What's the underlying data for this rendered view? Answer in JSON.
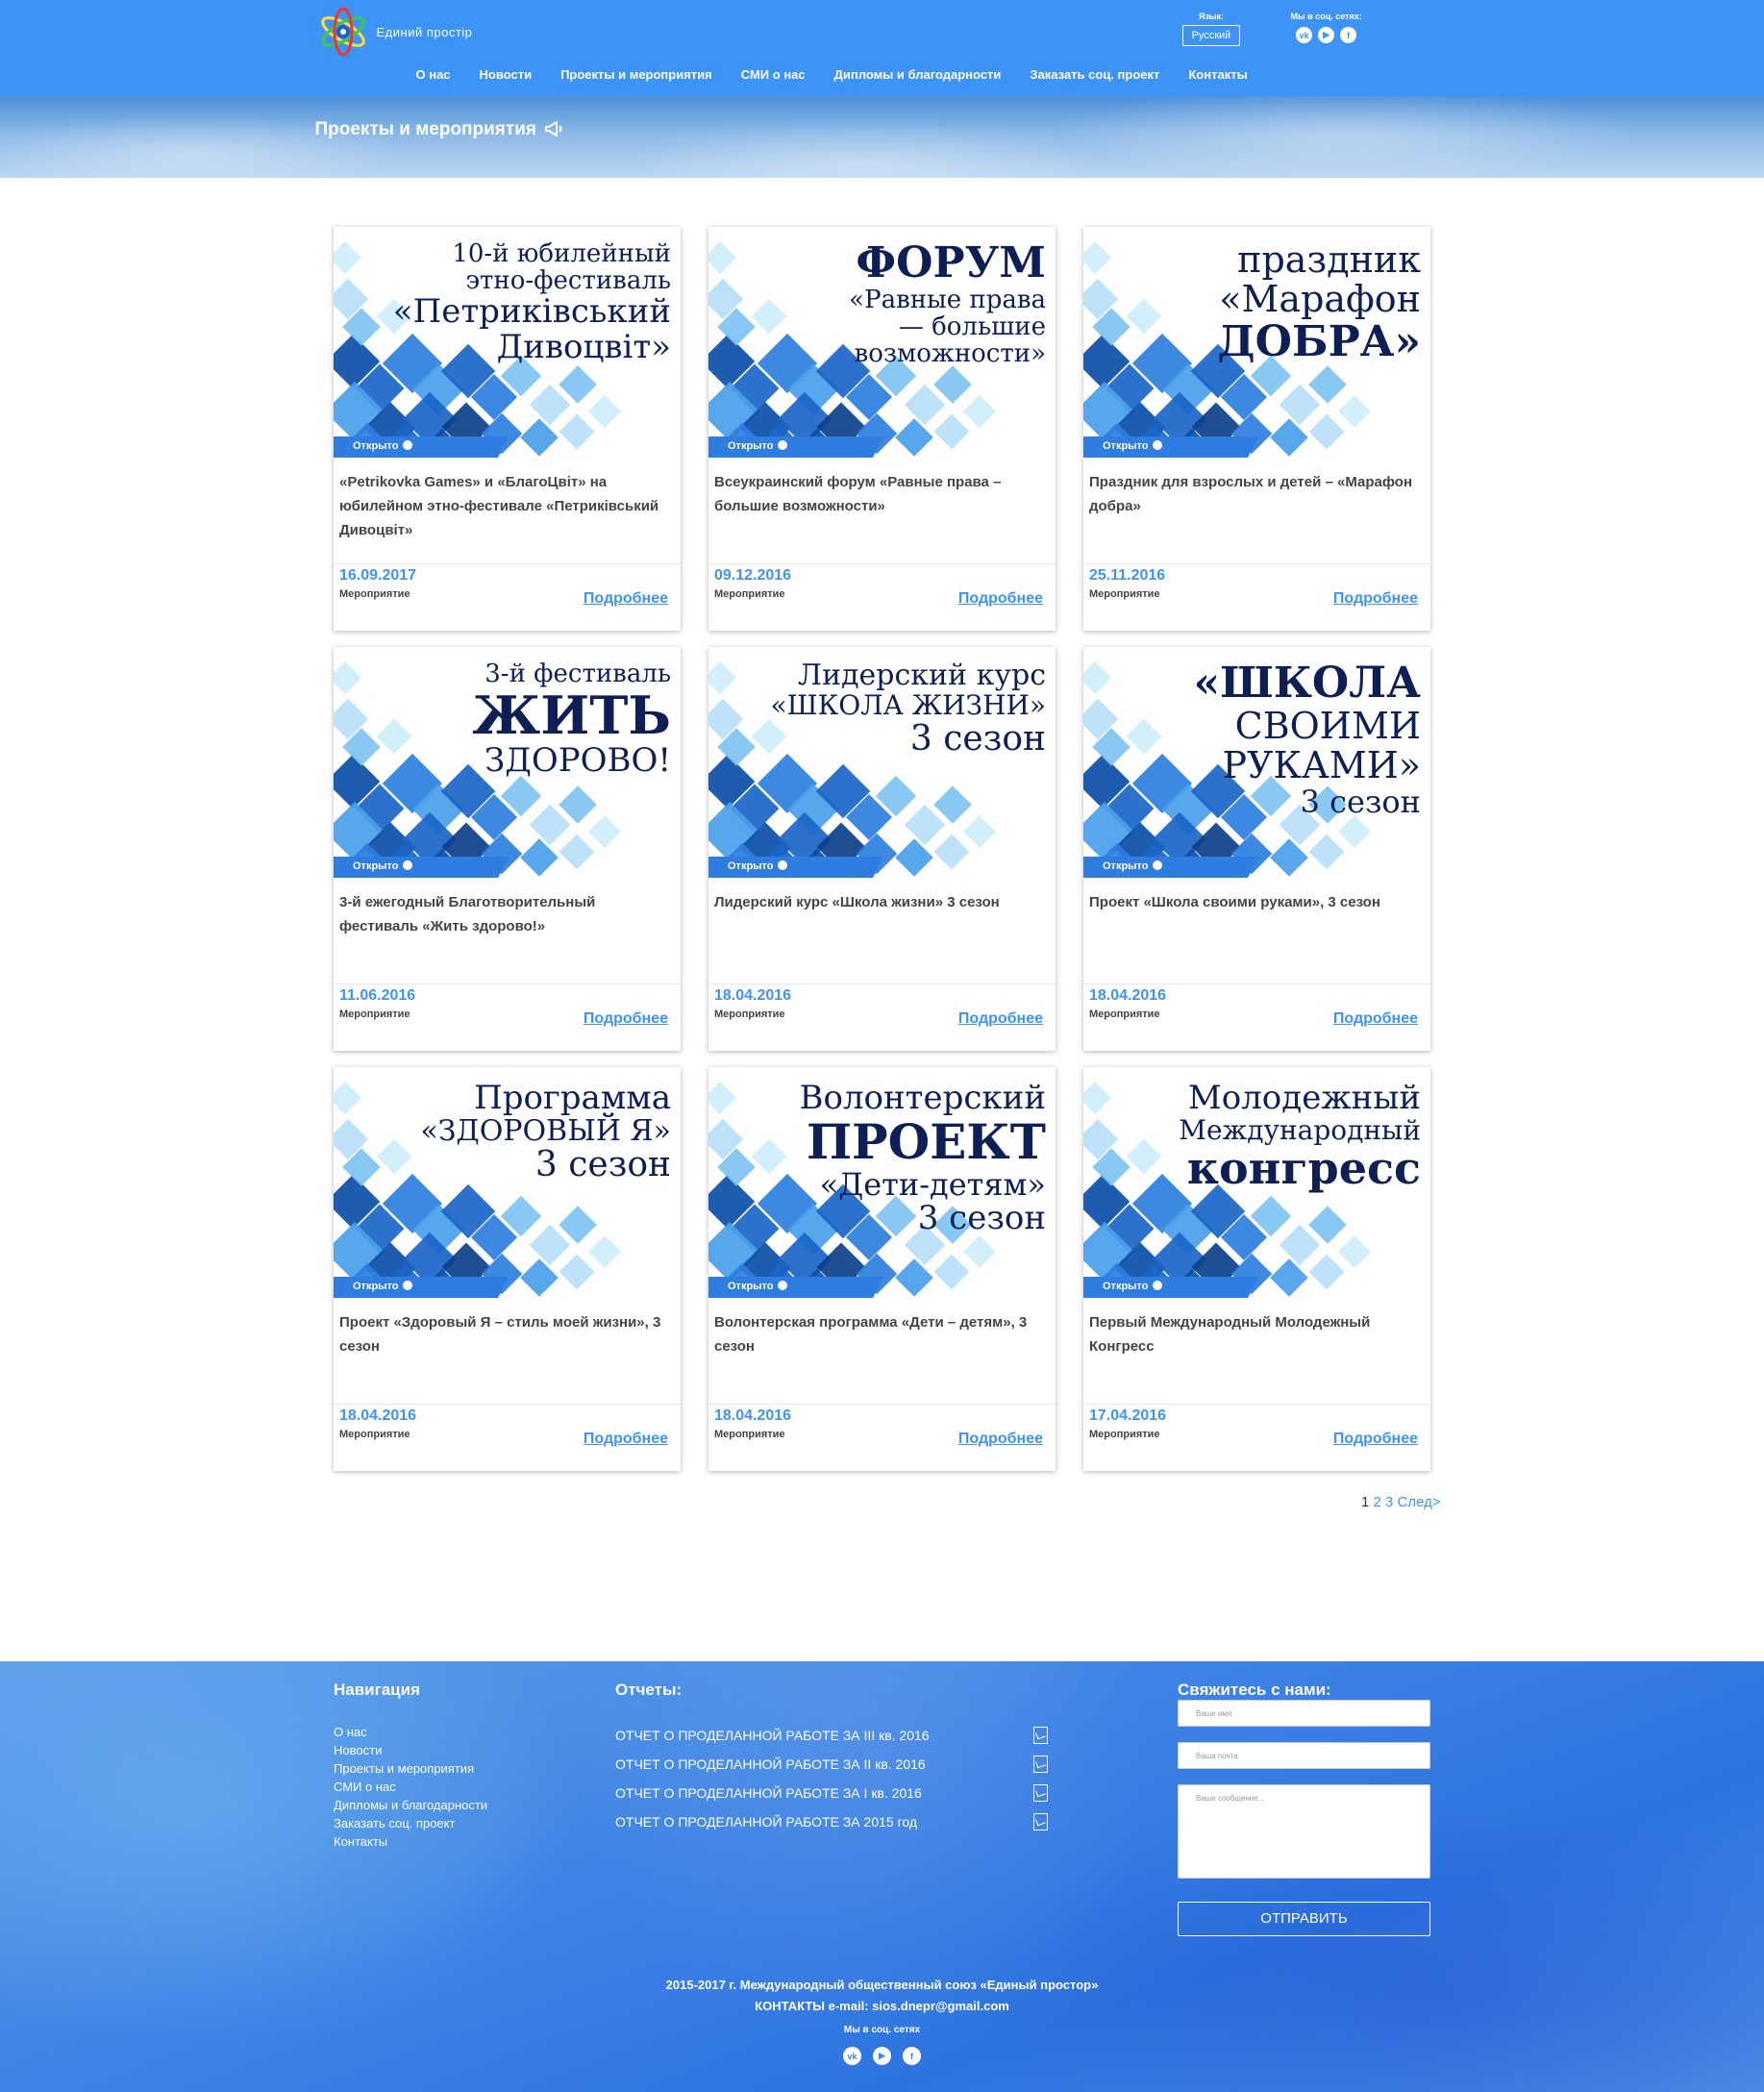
{
  "header": {
    "logo_text": "Единий простір",
    "lang_label": "Язык:",
    "lang_value": "Русский",
    "social_label": "Мы в соц. сетях:",
    "social_icons": [
      "vk-icon",
      "youtube-icon",
      "facebook-icon"
    ],
    "nav": [
      "О нас",
      "Новости",
      "Проекты и мероприятия",
      "СМИ о нас",
      "Дипломы и благодарности",
      "Заказать соц. проект",
      "Контакты"
    ]
  },
  "banner": {
    "title": "Проекты и мероприятия",
    "icon": "megaphone-icon"
  },
  "cards": [
    {
      "title_lines": [
        "10-й юбилейный",
        "этно-фестиваль",
        "«Петриківський",
        "Дивоцвіт»"
      ],
      "status": "Открыто",
      "text": "«Petrikovka Games» и «БлагоЦвіт» на юбилейном этно-фестивале «Петриківський Дивоцвіт»",
      "date": "16.09.2017",
      "type": "Мероприятие",
      "more": "Подробнее"
    },
    {
      "title_lines": [
        "ФОРУМ",
        "«Равные права",
        "— большие",
        "возможности»"
      ],
      "status": "Открыто",
      "text": "Всеукраинский форум «Равные права – большие возможности»",
      "date": "09.12.2016",
      "type": "Мероприятие",
      "more": "Подробнее"
    },
    {
      "title_lines": [
        "праздник",
        "«Марафон",
        "ДОБРА»"
      ],
      "status": "Открыто",
      "text": "Праздник для взрослых и детей – «Марафон добра»",
      "date": "25.11.2016",
      "type": "Мероприятие",
      "more": "Подробнее"
    },
    {
      "title_lines": [
        "3-й фестиваль",
        "ЖИТЬ",
        "ЗДОРОВО!"
      ],
      "status": "Открыто",
      "text": "3-й ежегодный Благотворительный фестиваль «Жить здорово!»",
      "date": "11.06.2016",
      "type": "Мероприятие",
      "more": "Подробнее"
    },
    {
      "title_lines": [
        "Лидерский курс",
        "«ШКОЛА ЖИЗНИ»",
        "3 сезон"
      ],
      "status": "Открыто",
      "text": "Лидерский курс «Школа жизни» 3 сезон",
      "date": "18.04.2016",
      "type": "Мероприятие",
      "more": "Подробнее"
    },
    {
      "title_lines": [
        "«ШКОЛА",
        "СВОИМИ",
        "РУКАМИ»",
        "3 сезон"
      ],
      "status": "Открыто",
      "text": "Проект «Школа своими руками», 3 сезон",
      "date": "18.04.2016",
      "type": "Мероприятие",
      "more": "Подробнее"
    },
    {
      "title_lines": [
        "Программа",
        "«ЗДОРОВЫЙ Я»",
        "3 сезон"
      ],
      "status": "Открыто",
      "text": "Проект «Здоровый Я – стиль моей жизни», 3 сезон",
      "date": "18.04.2016",
      "type": "Мероприятие",
      "more": "Подробнее"
    },
    {
      "title_lines": [
        "Волонтерский",
        "ПРОЕКТ",
        "«Дети-детям»",
        "3 сезон"
      ],
      "status": "Открыто",
      "text": "Волонтерская программа «Дети – детям», 3 сезон",
      "date": "18.04.2016",
      "type": "Мероприятие",
      "more": "Подробнее"
    },
    {
      "title_lines": [
        "Молодежный",
        "Международный",
        "конгресс"
      ],
      "status": "Открыто",
      "text": "Первый Международный Молодежный Конгресс",
      "date": "17.04.2016",
      "type": "Мероприятие",
      "more": "Подробнее"
    }
  ],
  "pagination": {
    "current": "1",
    "pages": [
      "2",
      "3"
    ],
    "next": "След>"
  },
  "footer": {
    "nav_title": "Навигация",
    "nav": [
      "О нас",
      "Новости",
      "Проекты и мероприятия",
      "СМИ о нас",
      "Дипломы и благодарности",
      "Заказать соц. проект",
      "Контакты"
    ],
    "reports_title": "Отчеты:",
    "reports": [
      "ОТЧЕТ О ПРОДЕЛАННОЙ РАБОТЕ ЗА III кв. 2016",
      "ОТЧЕТ О ПРОДЕЛАННОЙ РАБОТЕ ЗА II кв. 2016",
      "ОТЧЕТ О ПРОДЕЛАННОЙ РАБОТЕ ЗА I кв. 2016",
      "ОТЧЕТ О ПРОДЕЛАННОЙ РАБОТЕ ЗА 2015 год"
    ],
    "contact_title": "Свяжитесь с нами:",
    "name_placeholder": "Ваше имя",
    "email_placeholder": "Ваша почта",
    "message_placeholder": "Ваше сообщение...",
    "submit": "ОТПРАВИТЬ",
    "copyright": "2015-2017 г. Международный общественный союз «Единый простор»",
    "contacts": "КОНТАКТЫ e-mail: sios.dnepr@gmail.com",
    "social_label": "Мы в соц. сетях"
  },
  "colors": {
    "brand_blue": "#3d94f6",
    "title_navy": "#0e1f56",
    "ribbon_blue": "#2f7de0"
  }
}
